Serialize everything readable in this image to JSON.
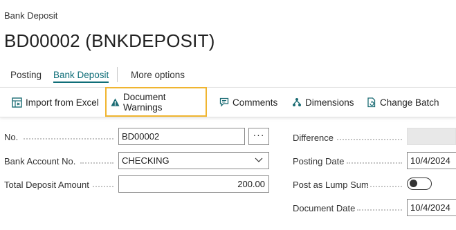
{
  "breadcrumb": "Bank Deposit",
  "page_title": "BD00002 (BNKDEPOSIT)",
  "nav_tabs": [
    {
      "label": "Posting",
      "active": false
    },
    {
      "label": "Bank Deposit",
      "active": true
    },
    {
      "label": "More options",
      "active": false
    }
  ],
  "actions": {
    "import_excel": "Import from Excel",
    "document_warnings": "Document Warnings",
    "comments": "Comments",
    "dimensions": "Dimensions",
    "change_batch": "Change Batch"
  },
  "fields": {
    "no": {
      "label": "No.",
      "value": "BD00002",
      "ellipsis": "···"
    },
    "bank_account_no": {
      "label": "Bank Account No.",
      "value": "CHECKING"
    },
    "total_deposit_amount": {
      "label": "Total Deposit Amount",
      "value": "200.00"
    },
    "difference": {
      "label": "Difference",
      "value": ""
    },
    "posting_date": {
      "label": "Posting Date",
      "value": "10/4/2024"
    },
    "post_as_lump_sum": {
      "label": "Post as Lump Sum",
      "value": false
    },
    "document_date": {
      "label": "Document Date",
      "value": "10/4/2024"
    }
  },
  "colors": {
    "accent": "#0f6e78",
    "selected_outline": "#f0b530",
    "warning_icon": "#1a6b73"
  }
}
